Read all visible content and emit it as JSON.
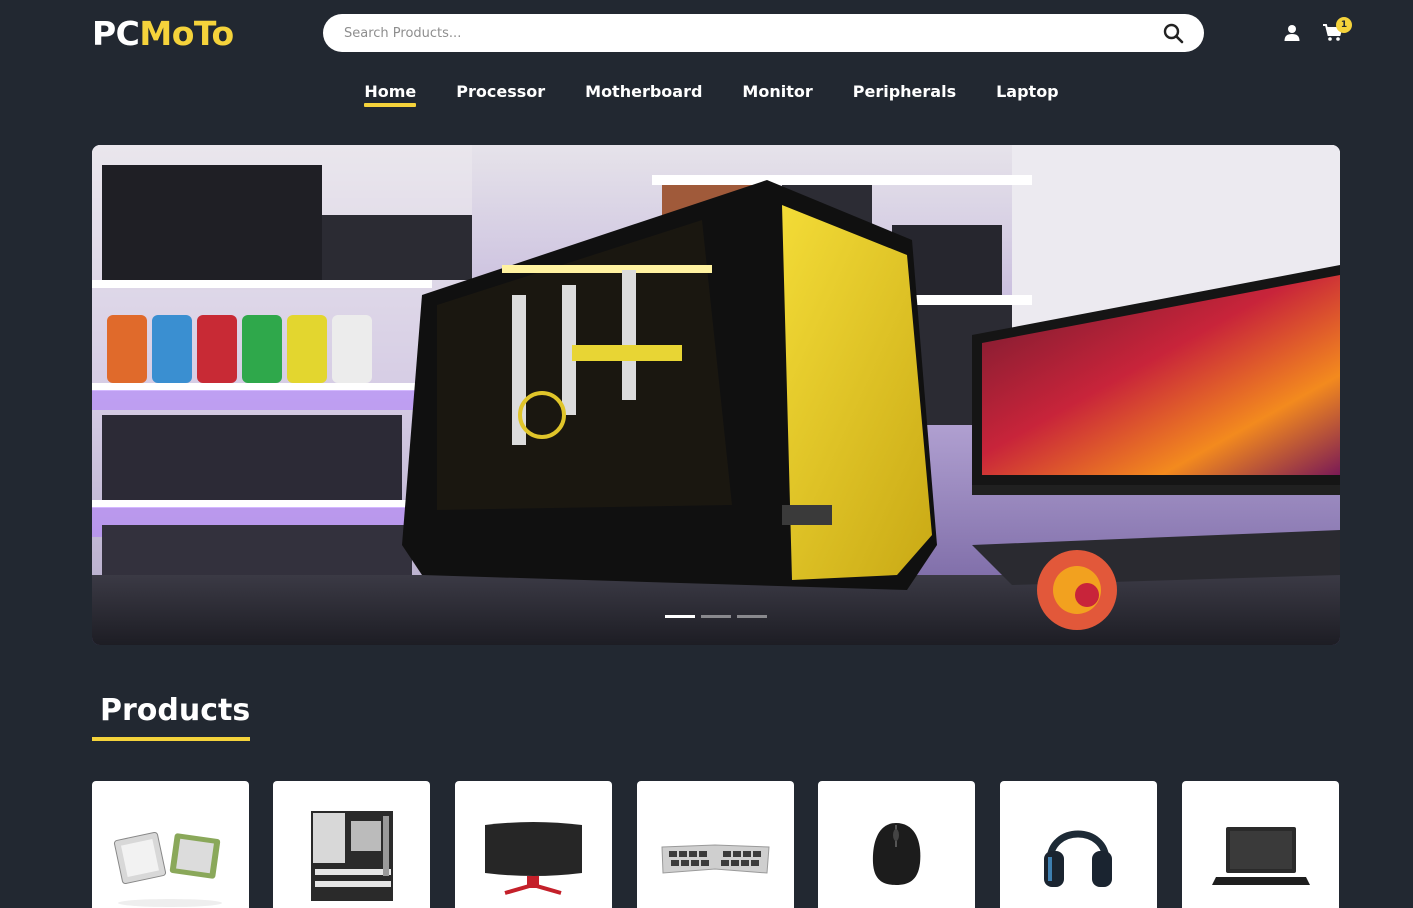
{
  "brand": {
    "part1": "PC",
    "part2": "MoTo"
  },
  "search": {
    "placeholder": "Search Products..."
  },
  "header": {
    "cart_count": "1"
  },
  "nav": {
    "items": [
      {
        "label": "Home",
        "active": true
      },
      {
        "label": "Processor"
      },
      {
        "label": "Motherboard"
      },
      {
        "label": "Monitor"
      },
      {
        "label": "Peripherals"
      },
      {
        "label": "Laptop"
      }
    ]
  },
  "hero": {
    "slides": 3,
    "active_slide": 1
  },
  "products": {
    "title": "Products",
    "cards": [
      {
        "icon": "processor-icon"
      },
      {
        "icon": "motherboard-icon"
      },
      {
        "icon": "monitor-icon"
      },
      {
        "icon": "keyboard-icon"
      },
      {
        "icon": "mouse-icon"
      },
      {
        "icon": "headset-icon"
      },
      {
        "icon": "laptop-icon"
      }
    ]
  },
  "colors": {
    "background": "#222831",
    "accent": "#f5d33b",
    "text": "#ffffff"
  }
}
